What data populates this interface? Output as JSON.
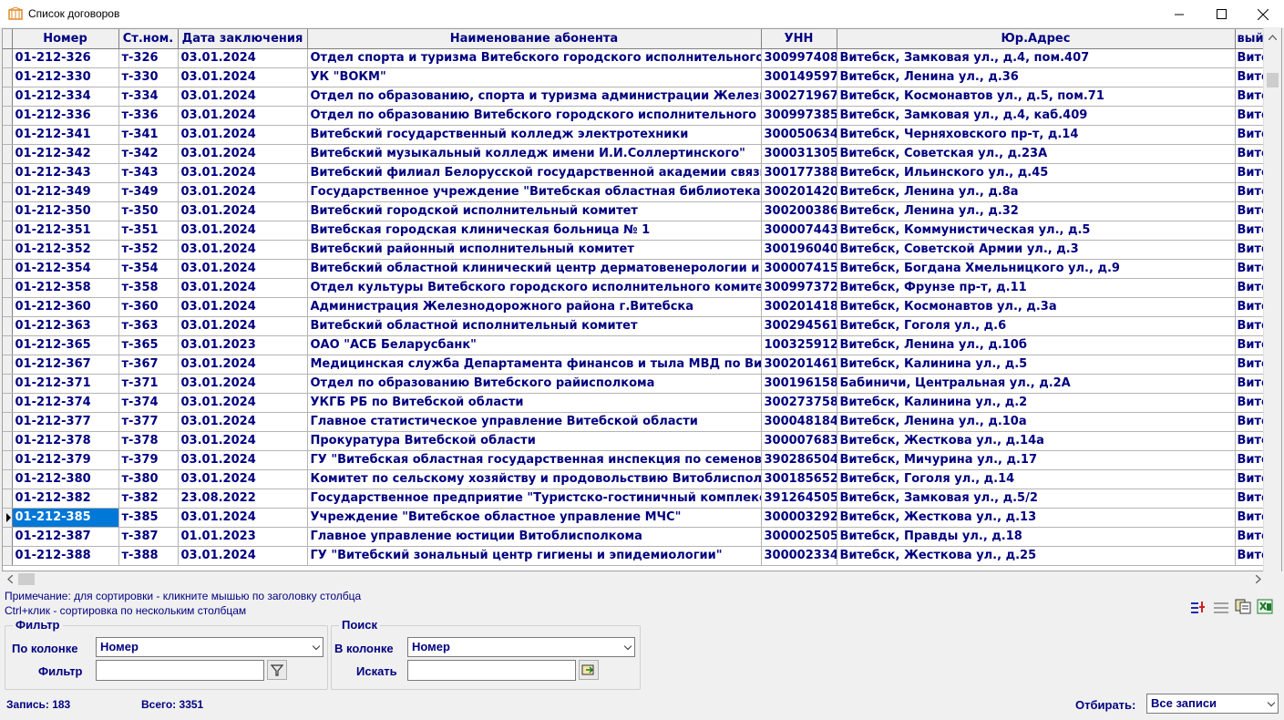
{
  "window": {
    "title": "Список договоров"
  },
  "columns": [
    "Номер",
    "Ст.ном.",
    "Дата заключения",
    "Наименование абонента",
    "УНН",
    "Юр.Адрес",
    "вый"
  ],
  "rows": [
    {
      "num": "01-212-326",
      "st": "т-326",
      "date": "03.01.2024",
      "name": "Отдел спорта и туризма Витебского городского исполнительного",
      "unn": "300997408",
      "addr": "Витебск, Замковая ул., д.4, пом.407",
      "extra": "Вито"
    },
    {
      "num": "01-212-330",
      "st": "т-330",
      "date": "03.01.2024",
      "name": "УК \"ВОКМ\"",
      "unn": "300149597",
      "addr": "Витебск, Ленина ул., д.36",
      "extra": "Вито"
    },
    {
      "num": "01-212-334",
      "st": "т-334",
      "date": "03.01.2024",
      "name": "Отдел по образованию, спорта и туризма администрации Железн",
      "unn": "300271967",
      "addr": "Витебск, Космонавтов ул., д.5, пом.71",
      "extra": "Вито"
    },
    {
      "num": "01-212-336",
      "st": "т-336",
      "date": "03.01.2024",
      "name": "Отдел по образованию Витебского городского исполнительного к",
      "unn": "300997385",
      "addr": "Витебск, Замковая ул., д.4, каб.409",
      "extra": "Вито"
    },
    {
      "num": "01-212-341",
      "st": "т-341",
      "date": "03.01.2024",
      "name": "Витебский государственный колледж электротехники",
      "unn": "300050634",
      "addr": "Витебск, Черняховского пр-т, д.14",
      "extra": "Вито"
    },
    {
      "num": "01-212-342",
      "st": "т-342",
      "date": "03.01.2024",
      "name": "Витебский музыкальный колледж имени И.И.Соллертинского\"",
      "unn": "300031305",
      "addr": "Витебск, Советская ул., д.23А",
      "extra": "Вито"
    },
    {
      "num": "01-212-343",
      "st": "т-343",
      "date": "03.01.2024",
      "name": "Витебский филиал Белорусской государственной академии связи",
      "unn": "300177388",
      "addr": "Витебск, Ильинского ул., д.45",
      "extra": "Вито"
    },
    {
      "num": "01-212-349",
      "st": "т-349",
      "date": "03.01.2024",
      "name": "Государственное учреждение \"Витебская областная библиотека и",
      "unn": "300201420",
      "addr": "Витебск, Ленина ул., д.8а",
      "extra": "Вито"
    },
    {
      "num": "01-212-350",
      "st": "т-350",
      "date": "03.01.2024",
      "name": "Витебский городской исполнительный комитет",
      "unn": "300200386",
      "addr": "Витебск, Ленина ул., д.32",
      "extra": "Вито"
    },
    {
      "num": "01-212-351",
      "st": "т-351",
      "date": "03.01.2024",
      "name": "Витебская городская клиническая больница № 1",
      "unn": "300007443",
      "addr": "Витебск, Коммунистическая ул., д.5",
      "extra": "Вито"
    },
    {
      "num": "01-212-352",
      "st": "т-352",
      "date": "03.01.2024",
      "name": "Витебский районный исполнительный комитет",
      "unn": "300196040",
      "addr": "Витебск, Советской Армии ул., д.3",
      "extra": "Вито"
    },
    {
      "num": "01-212-354",
      "st": "т-354",
      "date": "03.01.2024",
      "name": "Витебский областной клинический центр дерматовенерологии и к",
      "unn": "300007415",
      "addr": "Витебск, Богдана Хмельницкого ул., д.9",
      "extra": "Вито"
    },
    {
      "num": "01-212-358",
      "st": "т-358",
      "date": "03.01.2024",
      "name": "Отдел культуры Витебского городского исполнительного комитет",
      "unn": "300997372",
      "addr": "Витебск, Фрунзе пр-т, д.11",
      "extra": "Вито"
    },
    {
      "num": "01-212-360",
      "st": "т-360",
      "date": "03.01.2024",
      "name": "Администрация Железнодорожного района г.Витебска",
      "unn": "300201418",
      "addr": "Витебск, Космонавтов ул., д.3а",
      "extra": "Вито"
    },
    {
      "num": "01-212-363",
      "st": "т-363",
      "date": "03.01.2024",
      "name": "Витебский областной исполнительный комитет",
      "unn": "300294561",
      "addr": "Витебск, Гоголя ул., д.6",
      "extra": "Вито"
    },
    {
      "num": "01-212-365",
      "st": "т-365",
      "date": "03.01.2023",
      "name": " ОАО \"АСБ Беларусбанк\"",
      "unn": "100325912",
      "addr": "Витебск, Ленина ул., д.10б",
      "extra": "Вито"
    },
    {
      "num": "01-212-367",
      "st": "т-367",
      "date": "03.01.2024",
      "name": "Медицинская служба Департамента финансов и тыла МВД по Вите",
      "unn": "300201461",
      "addr": "Витебск, Калинина ул., д.5",
      "extra": "Вито"
    },
    {
      "num": "01-212-371",
      "st": "т-371",
      "date": "03.01.2024",
      "name": "Отдел по образованию Витебского райисполкома",
      "unn": "300196158",
      "addr": "Бабиничи, Центральная ул., д.2А",
      "extra": "Вито"
    },
    {
      "num": "01-212-374",
      "st": "т-374",
      "date": "03.01.2024",
      "name": "УКГБ РБ по Витебской области",
      "unn": "300273758",
      "addr": "Витебск, Калинина ул., д.2",
      "extra": "Вито"
    },
    {
      "num": "01-212-377",
      "st": "т-377",
      "date": "03.01.2024",
      "name": "Главное статистическое управление Витебской области",
      "unn": "300048184",
      "addr": "Витебск, Ленина ул., д.10а",
      "extra": "Вито"
    },
    {
      "num": "01-212-378",
      "st": "т-378",
      "date": "03.01.2024",
      "name": "Прокуратура Витебской области",
      "unn": "300007683",
      "addr": "Витебск, Жесткова ул., д.14а",
      "extra": "Вито"
    },
    {
      "num": "01-212-379",
      "st": "т-379",
      "date": "03.01.2024",
      "name": "ГУ \"Витебская областная государственная инспекция по семенов",
      "unn": "390286504",
      "addr": "Витебск, Мичурина ул., д.17",
      "extra": "Вито"
    },
    {
      "num": "01-212-380",
      "st": "т-380",
      "date": "03.01.2024",
      "name": "Комитет по сельскому хозяйству и продовольствию Витоблисполк",
      "unn": "300185652",
      "addr": "Витебск, Гоголя ул., д.14",
      "extra": "Вито"
    },
    {
      "num": "01-212-382",
      "st": "т-382",
      "date": "23.08.2022",
      "name": "Государственное предприятие \"Туристско-гостиничный комплекс",
      "unn": "391264505",
      "addr": "Витебск, Замковая ул., д.5/2",
      "extra": "Вито"
    },
    {
      "num": "01-212-385",
      "st": "т-385",
      "date": "03.01.2024",
      "name": "Учреждение \"Витебское областное управление МЧС\"",
      "unn": "300003292",
      "addr": "Витебск, Жесткова ул., д.13",
      "extra": "Вито",
      "selected": true
    },
    {
      "num": "01-212-387",
      "st": "т-387",
      "date": "01.01.2023",
      "name": "Главное управление юстиции Витоблисполкома",
      "unn": "300002505",
      "addr": "Витебск, Правды ул., д.18",
      "extra": "Вито"
    },
    {
      "num": "01-212-388",
      "st": "т-388",
      "date": "03.01.2024",
      "name": "ГУ \"Витебский зональный центр гигиены и эпидемиологии\"",
      "unn": "300002334",
      "addr": "Витебск, Жесткова ул., д.25",
      "extra": "Вито"
    }
  ],
  "notes": {
    "line1": "Примечание: для сортировки - кликните мышью по заголовку столбца",
    "line2": "Ctrl+клик - сортировка по нескольким столбцам"
  },
  "filter": {
    "legend": "Фильтр",
    "column_label": "По колонке",
    "column_value": "Номер",
    "filter_label": "Фильтр",
    "filter_value": ""
  },
  "search": {
    "legend": "Поиск",
    "column_label": "В колонке",
    "column_value": "Номер",
    "search_label": "Искать",
    "search_value": ""
  },
  "status": {
    "record": "Запись: 183",
    "total": "Всего: 3351",
    "select_label": "Отбирать:",
    "select_value": "Все записи"
  }
}
